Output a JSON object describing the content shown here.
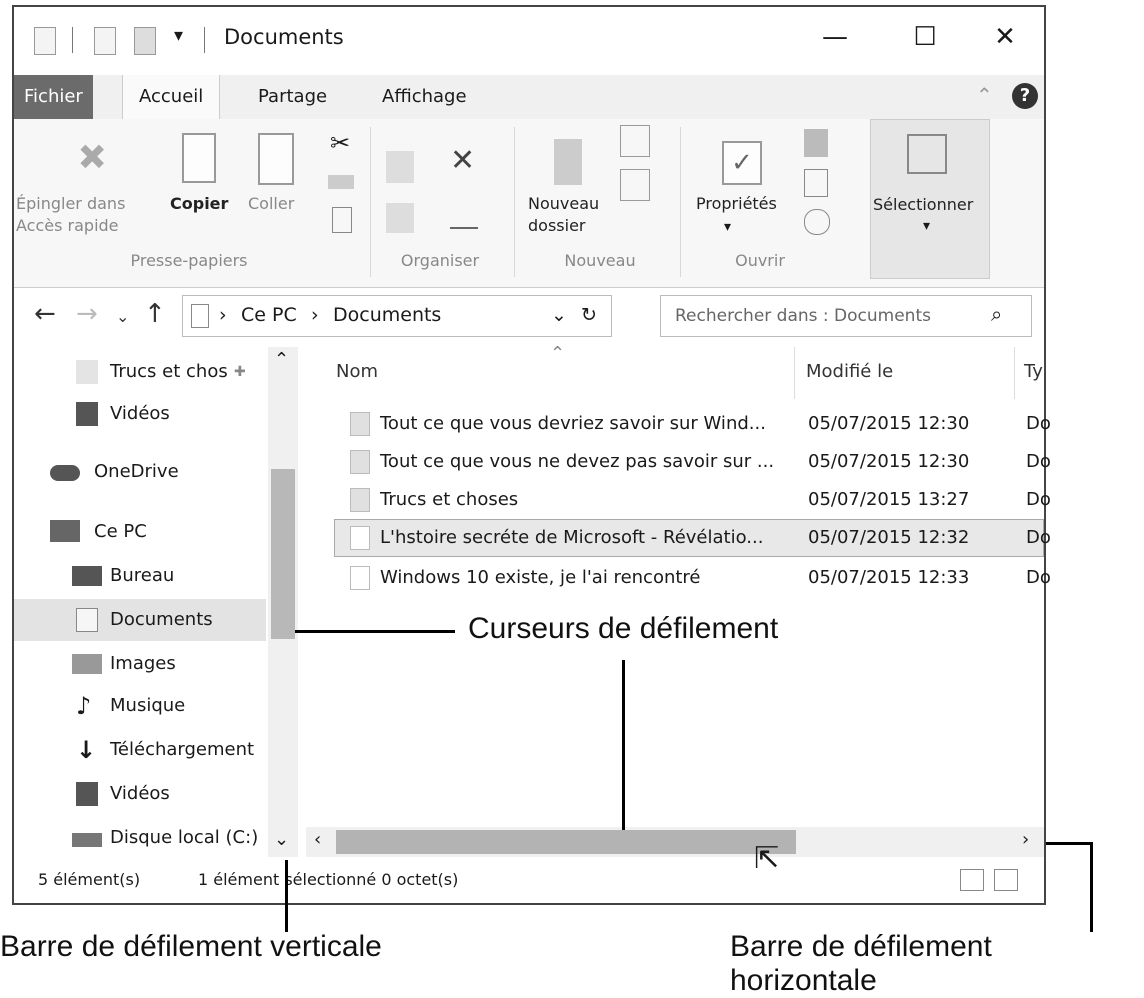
{
  "window": {
    "title": "Documents",
    "controls": {
      "minimize": "—",
      "maximize": "☐",
      "close": "✕"
    }
  },
  "ribbon_tabs": [
    "Fichier",
    "Accueil",
    "Partage",
    "Affichage"
  ],
  "ribbon": {
    "pin_label_1": "Épingler dans",
    "pin_label_2": "Accès rapide",
    "copy_label": "Copier",
    "paste_label": "Coller",
    "clipboard_group": "Presse-papiers",
    "organize_group": "Organiser",
    "new_folder_1": "Nouveau",
    "new_folder_2": "dossier",
    "new_group": "Nouveau",
    "properties_label": "Propriétés",
    "open_group": "Ouvrir",
    "select_label": "Sélectionner",
    "help": "?"
  },
  "address": {
    "root": "Ce PC",
    "folder": "Documents",
    "search_placeholder": "Rechercher dans : Documents"
  },
  "sidebar": {
    "items": [
      {
        "label": "Trucs et chos",
        "icon": "folder-icon"
      },
      {
        "label": "Vidéos",
        "icon": "video-icon"
      },
      {
        "label": "OneDrive",
        "icon": "cloud-icon"
      },
      {
        "label": "Ce PC",
        "icon": "computer-icon"
      },
      {
        "label": "Bureau",
        "icon": "desktop-icon"
      },
      {
        "label": "Documents",
        "icon": "document-icon"
      },
      {
        "label": "Images",
        "icon": "image-icon"
      },
      {
        "label": "Musique",
        "icon": "music-icon"
      },
      {
        "label": "Téléchargement",
        "icon": "download-icon"
      },
      {
        "label": "Vidéos",
        "icon": "video-icon"
      },
      {
        "label": "Disque local (C:)",
        "icon": "drive-icon"
      }
    ]
  },
  "columns": {
    "name": "Nom",
    "modified": "Modifié le",
    "type": "Ty"
  },
  "files": [
    {
      "name": "Tout ce que vous devriez savoir sur Wind...",
      "date": "05/07/2015 12:30",
      "type": "Do"
    },
    {
      "name": "Tout ce que vous ne devez pas savoir sur ...",
      "date": "05/07/2015 12:30",
      "type": "Do"
    },
    {
      "name": "Trucs et choses",
      "date": "05/07/2015 13:27",
      "type": "Do"
    },
    {
      "name": "L'hstoire secréte de Microsoft - Révélatio...",
      "date": "05/07/2015 12:32",
      "type": "Do"
    },
    {
      "name": "Windows 10 existe, je l'ai rencontré",
      "date": "05/07/2015 12:33",
      "type": "Do"
    }
  ],
  "status": {
    "count": "5 élément(s)",
    "selection": "1 élément sélectionné 0 octet(s)"
  },
  "callouts": {
    "scroll_cursors": "Curseurs de défilement",
    "vertical_bar": "Barre de défilement verticale",
    "horizontal_bar": "Barre de défilement horizontale"
  },
  "colors": {
    "file_tab": "#6b6b6b",
    "selection": "#e3e3e3",
    "scroll_thumb": "#b8b8b8"
  }
}
